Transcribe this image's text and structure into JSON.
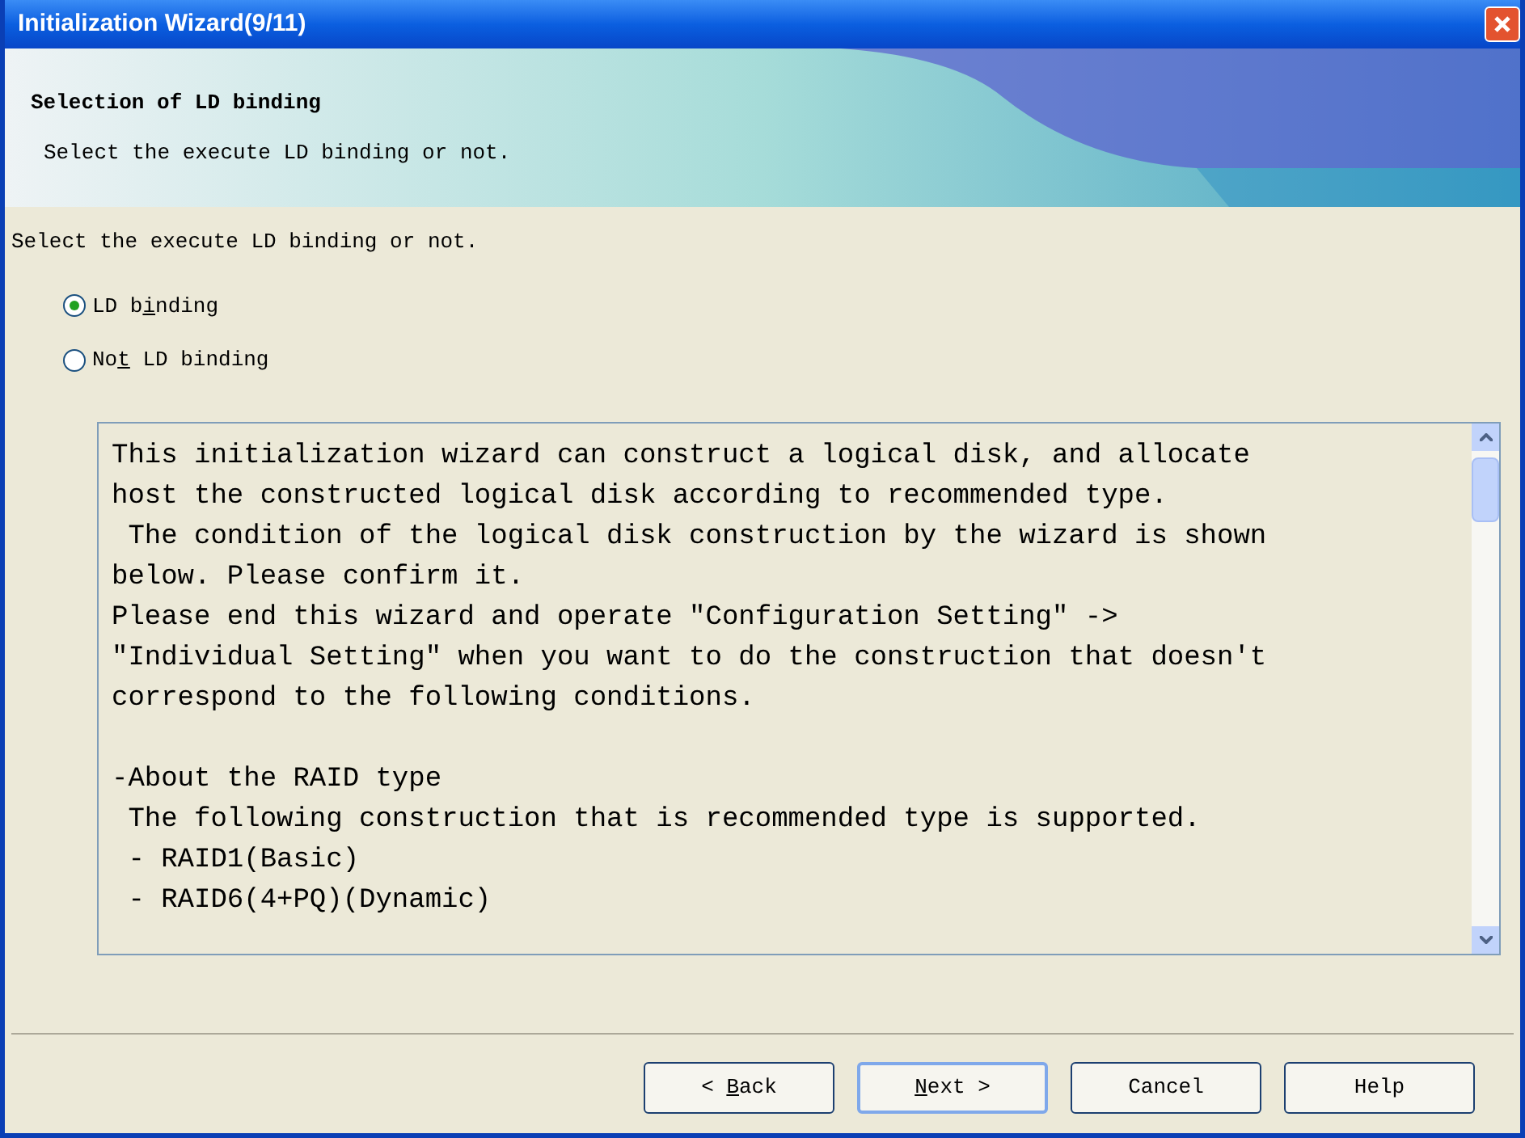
{
  "window": {
    "title": "Initialization Wizard(9/11)"
  },
  "header": {
    "title": "Selection of LD binding",
    "subtitle": "Select the execute LD binding or not."
  },
  "prompt": "Select the execute LD binding or not.",
  "options": [
    {
      "label": [
        {
          "text": "LD b",
          "underlined": false
        },
        {
          "text": "i",
          "underlined": true
        },
        {
          "text": "nding",
          "underlined": false
        }
      ],
      "selected": true
    },
    {
      "label": [
        {
          "text": "No",
          "underlined": false
        },
        {
          "text": "t",
          "underlined": true
        },
        {
          "text": " LD binding",
          "underlined": false
        }
      ],
      "selected": false
    }
  ],
  "description": [
    [
      "This initialization wizard can construct a logical disk, and allocate",
      "host the constructed logical disk according to recommended type.",
      " The condition of the logical disk construction by the wizard is shown",
      "below. Please confirm it.",
      "Please end this wizard and operate \"Configuration Setting\" ->",
      "\"Individual Setting\" when you want to do the construction that doesn't",
      "correspond to the following conditions."
    ],
    [
      "-About the RAID type",
      " The following construction that is recommended type is supported.",
      " - RAID1(Basic)",
      " - RAID6(4+PQ)(Dynamic)"
    ]
  ],
  "buttons": [
    {
      "label": [
        {
          "text": "< ",
          "underlined": false
        },
        {
          "text": "B",
          "underlined": true
        },
        {
          "text": "ack",
          "underlined": false
        }
      ],
      "default": false
    },
    {
      "label": [
        {
          "text": "N",
          "underlined": true
        },
        {
          "text": "ext >",
          "underlined": false
        }
      ],
      "default": true
    },
    {
      "label": [
        {
          "text": "Cancel",
          "underlined": false
        }
      ],
      "default": false
    },
    {
      "label": [
        {
          "text": "Help",
          "underlined": false
        }
      ],
      "default": false
    }
  ]
}
